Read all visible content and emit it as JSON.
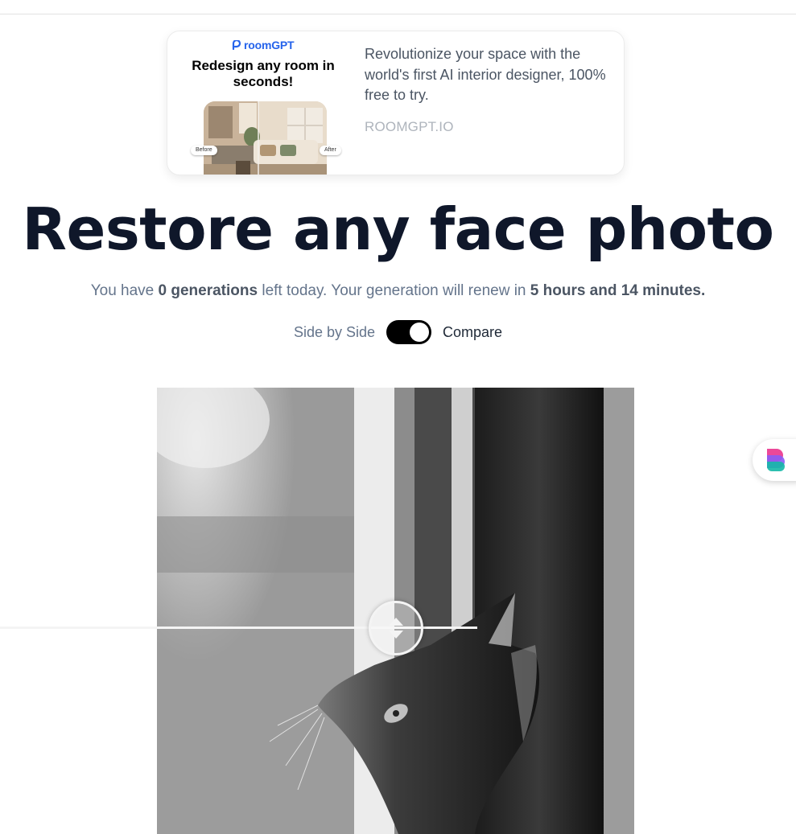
{
  "ad": {
    "logo_text": "roomGPT",
    "headline": "Redesign any room in seconds!",
    "before_label": "Before",
    "after_label": "After",
    "description": "Revolutionize your space with the world's first AI interior designer, 100% free to try.",
    "url": "ROOMGPT.IO"
  },
  "title": "Restore any face photo",
  "quota": {
    "prefix": "You have ",
    "generations": "0 generations",
    "middle": " left today. Your generation will renew in ",
    "renew_time": "5 hours and 14 minutes."
  },
  "toggle": {
    "left_label": "Side by Side",
    "right_label": "Compare",
    "state": "on"
  },
  "colors": {
    "title": "#0f172a",
    "muted_text": "#64748b",
    "accent_blue": "#2563eb"
  }
}
